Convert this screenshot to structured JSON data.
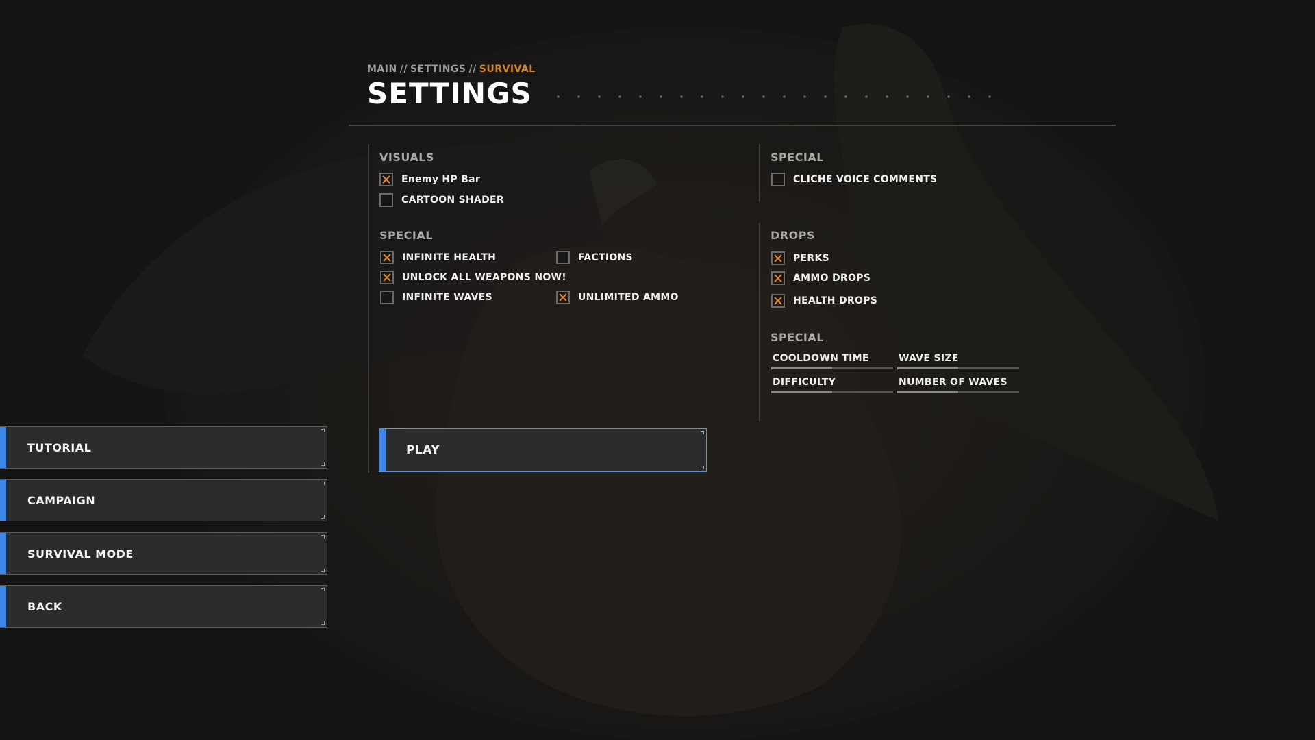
{
  "breadcrumb": {
    "main": "MAIN",
    "settings": "SETTINGS",
    "current": "SURVIVAL",
    "separator": "//"
  },
  "title": "SETTINGS",
  "colors": {
    "accent_blue": "#3d86e6",
    "accent_orange": "#d1852a",
    "check_orange": "#e0832a"
  },
  "visuals": {
    "title": "VISUALS",
    "options": [
      {
        "label": "Enemy HP Bar",
        "checked": true
      },
      {
        "label": "CARTOON SHADER",
        "checked": false
      }
    ]
  },
  "special_left": {
    "title": "SPECIAL",
    "options": [
      {
        "label": "INFINITE HEALTH",
        "checked": true
      },
      {
        "label": "UNLOCK ALL WEAPONS NOW!",
        "checked": true
      },
      {
        "label": "INFINITE WAVES",
        "checked": false
      },
      {
        "label": "FACTIONS",
        "checked": false
      },
      {
        "label": "UNLIMITED AMMO",
        "checked": true
      }
    ]
  },
  "special_right": {
    "title": "SPECIAL",
    "options": [
      {
        "label": "CLICHE VOICE COMMENTS",
        "checked": false
      }
    ]
  },
  "drops": {
    "title": "DROPS",
    "options": [
      {
        "label": "PERKS",
        "checked": true
      },
      {
        "label": "AMMO DROPS",
        "checked": true
      },
      {
        "label": "HEALTH DROPS",
        "checked": true
      }
    ]
  },
  "special_sliders": {
    "title": "SPECIAL",
    "sliders": [
      {
        "label": "COOLDOWN TIME",
        "level": 0.5
      },
      {
        "label": "WAVE SIZE",
        "level": 0.5
      },
      {
        "label": "DIFFICULTY",
        "level": 0.5
      },
      {
        "label": "NUMBER OF WAVES",
        "level": 0.5
      }
    ]
  },
  "menu": {
    "items": [
      {
        "label": "TUTORIAL"
      },
      {
        "label": "CAMPAIGN"
      },
      {
        "label": "SURVIVAL MODE"
      },
      {
        "label": "BACK"
      }
    ]
  },
  "play_label": "PLAY"
}
